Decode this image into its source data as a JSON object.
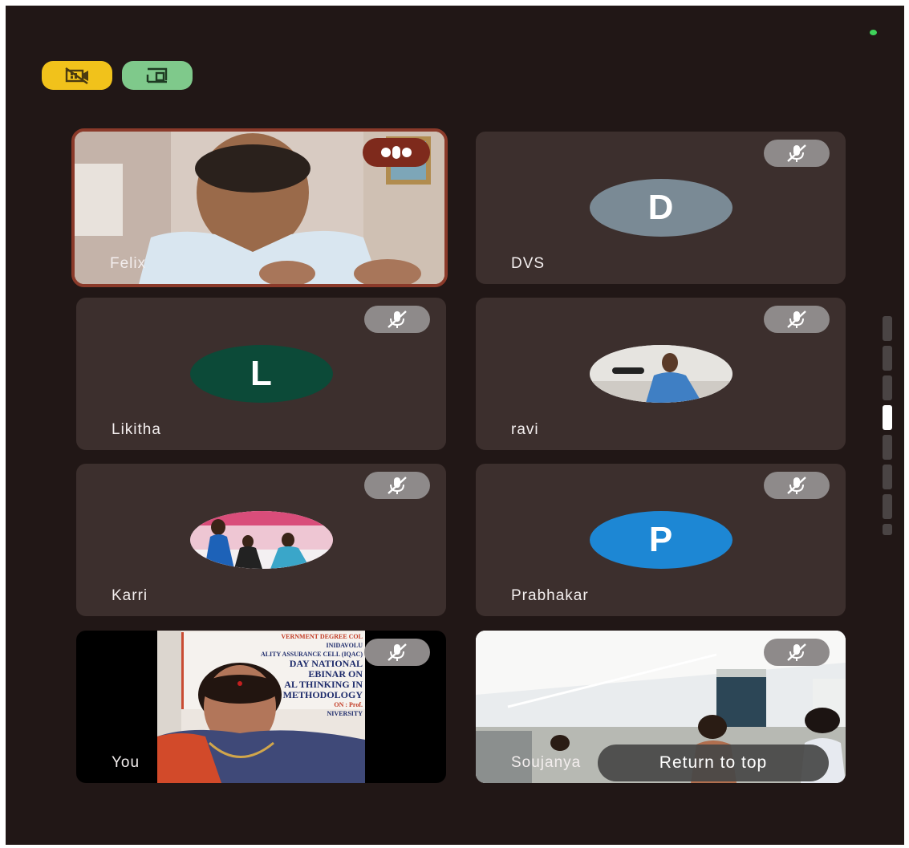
{
  "toolbar": {
    "camera_off_icon": "video-off-icon",
    "screen_share_icon": "cast-icon",
    "colors": {
      "camera_off_bg": "#f1c21b",
      "screen_share_bg": "#7fc98b"
    }
  },
  "participants": [
    {
      "name": "Felix",
      "avatar": "video",
      "speaking": true
    },
    {
      "name": "DVS",
      "avatar_letter": "D",
      "avatar_color": "#7a8a95",
      "muted": true
    },
    {
      "name": "Likitha",
      "avatar_letter": "L",
      "avatar_color": "#0c4a38",
      "muted": true
    },
    {
      "name": "ravi",
      "avatar": "photo",
      "muted": true
    },
    {
      "name": "Karri",
      "avatar": "photo",
      "muted": true
    },
    {
      "name": "Prabhakar",
      "avatar_letter": "P",
      "avatar_color": "#1d87d4",
      "muted": true
    },
    {
      "name": "You",
      "avatar": "video",
      "muted": true
    },
    {
      "name": "Soujanya",
      "avatar": "video",
      "muted": true
    }
  ],
  "banner_text": {
    "line1": "VERNMENT DEGREE COL",
    "line2": "INIDAVOLU",
    "line3": "ALITY ASSURANCE CELL (IQAC)",
    "line4": "DAY NATIONAL",
    "line5": "EBINAR ON",
    "line6": "AL THINKING IN",
    "line7": "H METHODOLOGY",
    "line8": "ON : Prof.",
    "line9": "NIVERSITY"
  },
  "return_to_top_label": "Return to top",
  "scrollbar": {
    "segments": 8,
    "active_index": 3
  }
}
